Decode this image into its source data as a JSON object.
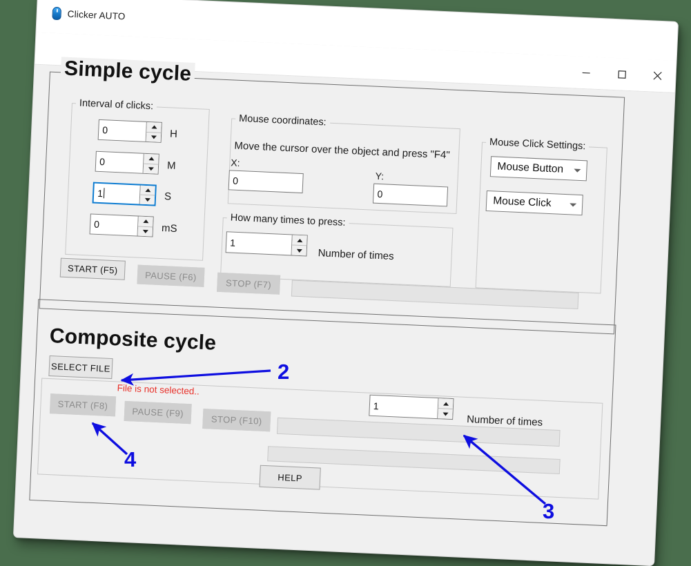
{
  "window": {
    "title": "Clicker AUTO",
    "app_icon": "mouse-icon",
    "controls": {
      "minimize": "minimize-icon",
      "maximize": "maximize-icon",
      "close": "close-icon"
    }
  },
  "simple_cycle": {
    "title": "Simple cycle",
    "interval": {
      "label": "Interval of clicks:",
      "fields": [
        {
          "value": "0",
          "unit": "H",
          "focused": false
        },
        {
          "value": "0",
          "unit": "M",
          "focused": false
        },
        {
          "value": "1",
          "unit": "S",
          "focused": true
        },
        {
          "value": "0",
          "unit": "mS",
          "focused": false
        }
      ]
    },
    "coordinates": {
      "label": "Mouse coordinates:",
      "instruction": "Move the cursor over the object and press \"F4\"",
      "x_label": "X:",
      "x_value": "0",
      "y_label": "Y:",
      "y_value": "0"
    },
    "press_count": {
      "label": "How many times to press:",
      "value": "1",
      "units_label": "Number of times"
    },
    "click_settings": {
      "label": "Mouse Click Settings:",
      "button_select": "Mouse Button",
      "click_select": "Mouse Click"
    },
    "buttons": {
      "start": {
        "label": "START (F5)",
        "enabled": true
      },
      "pause": {
        "label": "PAUSE (F6)",
        "enabled": false
      },
      "stop": {
        "label": "STOP (F7)",
        "enabled": false
      }
    }
  },
  "composite_cycle": {
    "title": "Composite cycle",
    "select_file": "SELECT FILE",
    "file_status": "File is not selected..",
    "buttons": {
      "start": {
        "label": "START (F8)",
        "enabled": false
      },
      "pause": {
        "label": "PAUSE (F9)",
        "enabled": false
      },
      "stop": {
        "label": "STOP (F10)",
        "enabled": false
      }
    },
    "repeat": {
      "value": "1",
      "units_label": "Number of times"
    }
  },
  "help_button": "HELP",
  "annotations": [
    {
      "number": "2"
    },
    {
      "number": "3"
    },
    {
      "number": "4"
    }
  ],
  "colors": {
    "background": "#4a6e4d",
    "window": "#f0f0f0",
    "accent_blue": "#0e0ee0",
    "error_red": "#e8312a",
    "focus_blue": "#0a7ad0"
  }
}
